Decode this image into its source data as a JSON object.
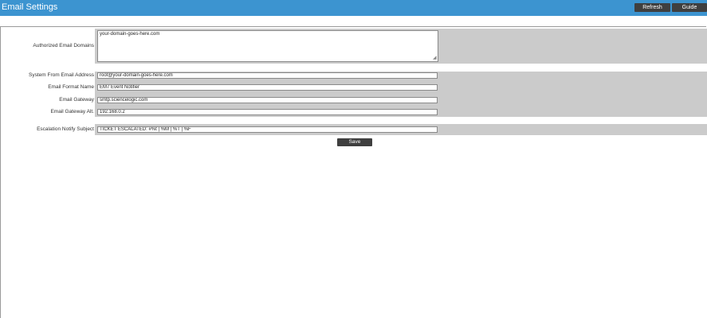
{
  "header": {
    "title": "Email Settings",
    "refresh_label": "Refresh",
    "guide_label": "Guide"
  },
  "form": {
    "authorized_domains": {
      "label": "Authorized Email Domains",
      "value": "your-domain-goes-here.com"
    },
    "from_address": {
      "label": "System From Email Address",
      "value": "root@your-domain-goes-here.com"
    },
    "format_name": {
      "label": "Email Format Name",
      "value": "EM7 Event Notifier"
    },
    "gateway": {
      "label": "Email Gateway",
      "value": "smtp.sciencelogic.com"
    },
    "gateway_alt": {
      "label": "Email Gateway Alt.",
      "value": "192.168.0.2"
    },
    "escalation_subject": {
      "label": "Escalation Notify Subject",
      "value": "TICKET ESCALATED: #%t | %M | %T | %F"
    },
    "save_label": "Save"
  },
  "colors": {
    "header_bg": "#3c94d0",
    "button_bg": "#3f3f3f",
    "row_bg": "#cbcbcb"
  }
}
